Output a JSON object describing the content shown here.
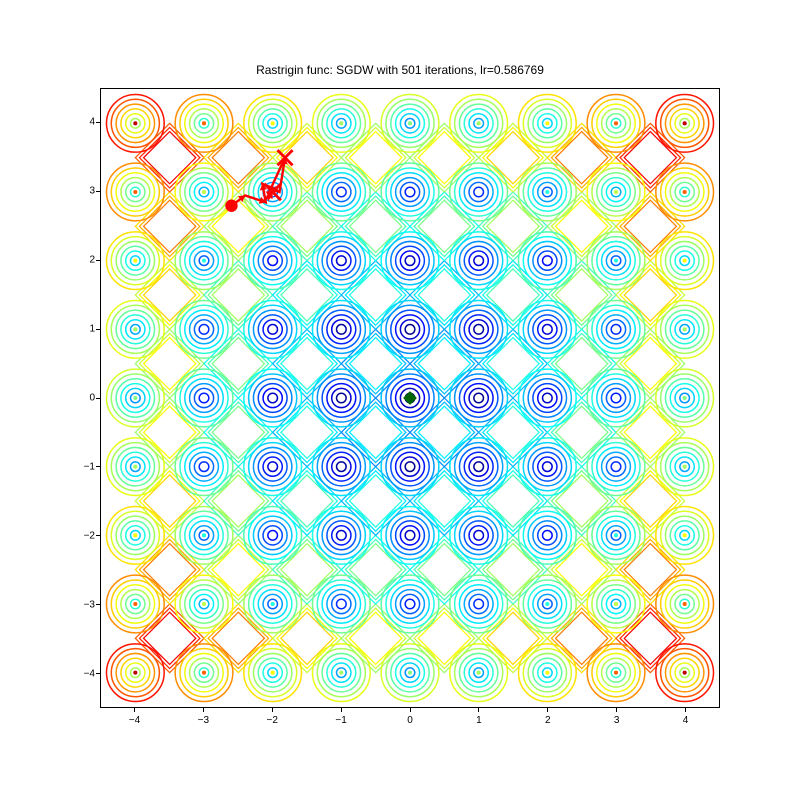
{
  "chart_data": {
    "type": "contour",
    "title": "Rastrigin func: SGDW with 501 iterations, lr=0.586769",
    "xlabel": "",
    "ylabel": "",
    "xlim": [
      -4.5,
      4.5
    ],
    "ylim": [
      -4.5,
      4.5
    ],
    "xticks": [
      -4,
      -3,
      -2,
      -1,
      0,
      1,
      2,
      3,
      4
    ],
    "yticks": [
      -4,
      -3,
      -2,
      -1,
      0,
      1,
      2,
      3,
      4
    ],
    "function": "Rastrigin",
    "grid_period": 1.0,
    "contour_colormap": "jet",
    "minimum_marker": {
      "x": 0.0,
      "y": 0.0,
      "color": "#006400",
      "symbol": "diamond"
    },
    "optimizer_trajectory": {
      "color": "#FF0000",
      "start_marker": "circle",
      "end_marker": "x",
      "points": [
        {
          "x": -2.6,
          "y": 2.8
        },
        {
          "x": -2.4,
          "y": 2.95
        },
        {
          "x": -2.1,
          "y": 2.85
        },
        {
          "x": -2.15,
          "y": 3.12
        },
        {
          "x": -1.9,
          "y": 3.0
        },
        {
          "x": -1.82,
          "y": 3.5
        },
        {
          "x": -2.05,
          "y": 3.0
        },
        {
          "x": -2.05,
          "y": 2.92
        },
        {
          "x": -2.0,
          "y": 3.0
        }
      ]
    }
  }
}
